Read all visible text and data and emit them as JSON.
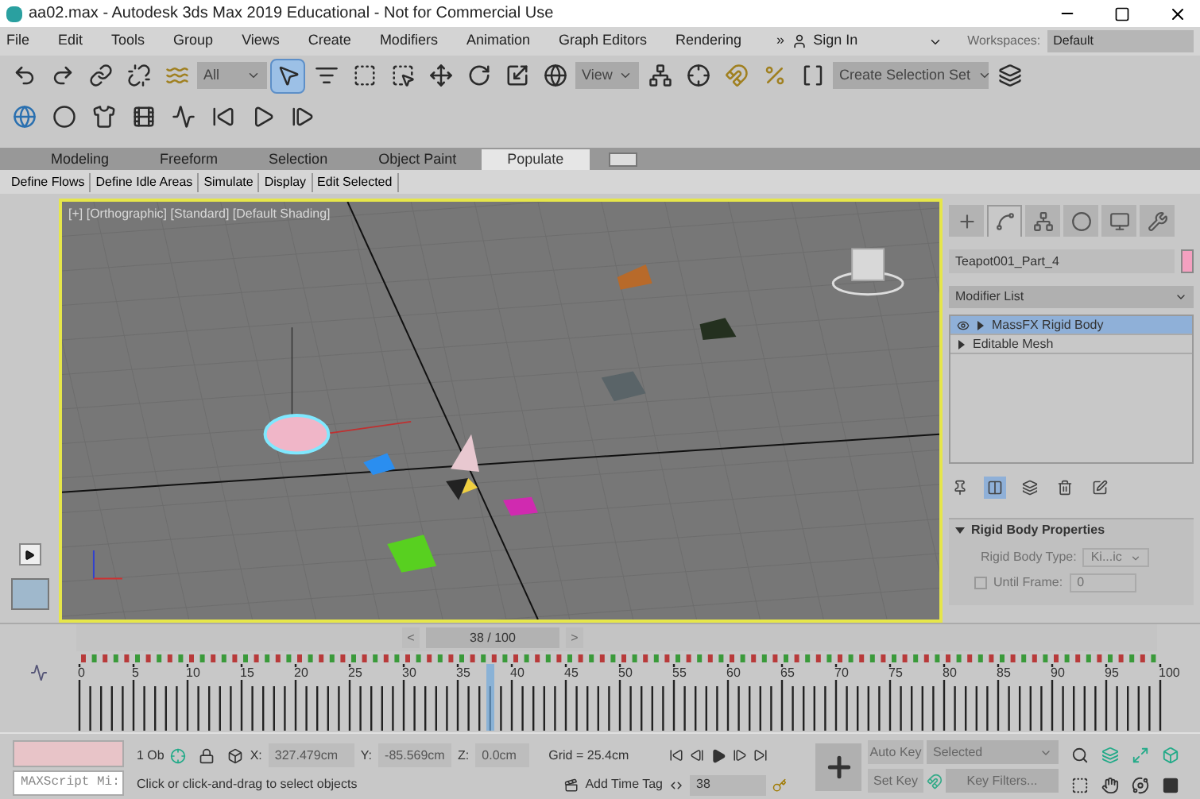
{
  "window": {
    "title": "aa02.max - Autodesk 3ds Max 2019 Educational - Not for Commercial Use"
  },
  "menu": [
    "File",
    "Edit",
    "Tools",
    "Group",
    "Views",
    "Create",
    "Modifiers",
    "Animation",
    "Graph Editors",
    "Rendering"
  ],
  "menu_more": "»",
  "sign_in": "Sign In",
  "workspaces_label": "Workspaces:",
  "workspace": "Default",
  "toolbar": {
    "selection_filter": "All",
    "reference_coordinate": "View",
    "named_selection": "Create Selection Set",
    "tools": [
      {
        "selected": true
      },
      {
        "selected": false
      },
      {
        "selected": false
      },
      {
        "selected": false
      }
    ]
  },
  "ribbon_tabs": [
    {
      "label": "Modeling",
      "selected": false
    },
    {
      "label": "Freeform",
      "selected": false
    },
    {
      "label": "Selection",
      "selected": false
    },
    {
      "label": "Object Paint",
      "selected": false
    },
    {
      "label": "Populate",
      "selected": true
    }
  ],
  "ribbon_panels": [
    "Define Flows",
    "Define Idle Areas",
    "Simulate",
    "Display",
    "Edit Selected"
  ],
  "viewport": {
    "label": "[+] [Orthographic] [Standard] [Default Shading]",
    "active": true
  },
  "command_panel": {
    "tabs": [
      {
        "selected": false
      },
      {
        "selected": true
      },
      {
        "selected": false
      },
      {
        "selected": false
      },
      {
        "selected": false
      },
      {
        "selected": false
      }
    ],
    "object_name": "Teapot001_Part_4",
    "modifier_list": "Modifier List",
    "stack": [
      {
        "label": "MassFX Rigid Body",
        "selected": true
      },
      {
        "label": "Editable Mesh",
        "selected": false
      }
    ],
    "stack_tools": [
      {
        "selected": false
      },
      {
        "selected": true
      },
      {
        "selected": false
      },
      {
        "selected": false
      },
      {
        "selected": false
      }
    ],
    "rollout": {
      "title": "Rigid Body Properties",
      "expanded": true,
      "type_label": "Rigid Body Type:",
      "type": "Ki...ic",
      "until_frame_label": "Until Frame:",
      "until_frame_checked": false,
      "until_frame": "0"
    }
  },
  "time_slider": {
    "prev": "<",
    "label": "38 / 100",
    "next": ">"
  },
  "track_bar": {
    "labels": [
      "0",
      "5",
      "10",
      "15",
      "20",
      "25",
      "30",
      "35",
      "40",
      "45",
      "50",
      "55",
      "60",
      "65",
      "70",
      "75",
      "80",
      "85",
      "90",
      "95",
      "100"
    ]
  },
  "status": {
    "maxscript": "MAXScript Mi:",
    "selection": "1 Ob",
    "x_label": "X:",
    "x": "327.479cm",
    "y_label": "Y:",
    "y": "-85.569cm",
    "z_label": "Z:",
    "z": "0.0cm",
    "grid": "Grid = 25.4cm",
    "prompt": "Click or click-and-drag to select objects",
    "add_time_tag": "Add Time Tag",
    "frame": "38",
    "auto_key": "Auto Key",
    "key_mode": "Selected",
    "set_key": "Set Key",
    "key_filters": "Key Filters..."
  }
}
